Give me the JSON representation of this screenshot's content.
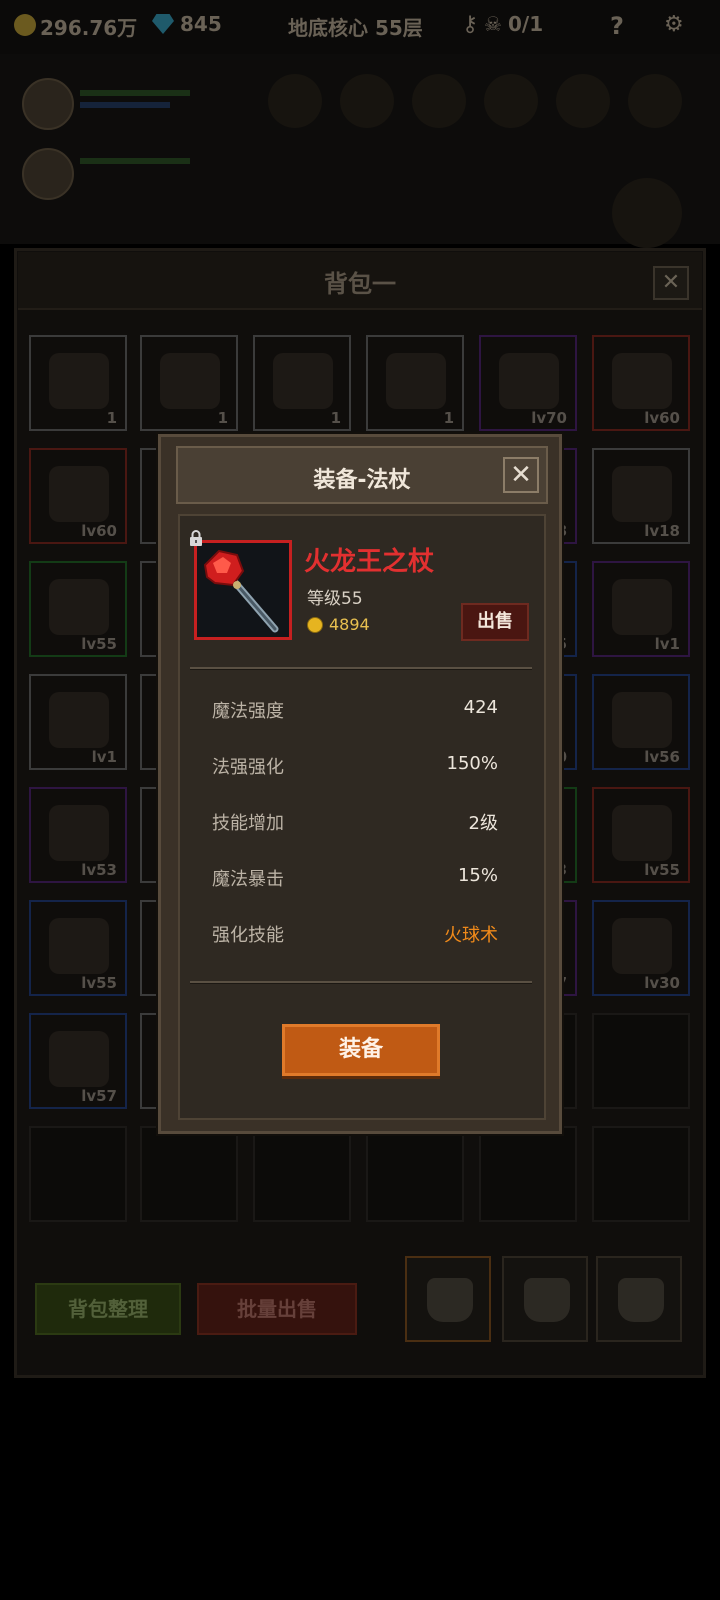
{
  "topbar": {
    "gold": "296.76万",
    "gems": "845",
    "location": "地底核心 55层",
    "keys": "0/1"
  },
  "bag": {
    "title": "背包一",
    "close_label": "✕",
    "slots": [
      {
        "count": "1"
      },
      {
        "count": "1"
      },
      {
        "count": "1"
      },
      {
        "count": "1"
      },
      {
        "count": "lv70"
      },
      {
        "count": "lv60"
      },
      {
        "count": "lv60"
      },
      {
        "count": ""
      },
      {
        "count": ""
      },
      {
        "count": ""
      },
      {
        "count": "8"
      },
      {
        "count": "lv18"
      },
      {
        "count": "lv55"
      },
      {
        "count": ""
      },
      {
        "count": ""
      },
      {
        "count": ""
      },
      {
        "count": "5"
      },
      {
        "count": "lv1"
      },
      {
        "count": "lv1"
      },
      {
        "count": ""
      },
      {
        "count": ""
      },
      {
        "count": ""
      },
      {
        "count": "0"
      },
      {
        "count": "lv56"
      },
      {
        "count": "lv53"
      },
      {
        "count": ""
      },
      {
        "count": ""
      },
      {
        "count": ""
      },
      {
        "count": "3"
      },
      {
        "count": "lv55"
      },
      {
        "count": "lv55"
      },
      {
        "count": ""
      },
      {
        "count": ""
      },
      {
        "count": ""
      },
      {
        "count": "7"
      },
      {
        "count": "lv30"
      },
      {
        "count": "lv57"
      },
      {
        "count": ""
      },
      {
        "count": ""
      },
      {
        "count": ""
      },
      {
        "count": ""
      },
      {
        "count": ""
      }
    ],
    "sort_label": "背包整理",
    "batch_sell_label": "批量出售"
  },
  "dialog": {
    "title": "装备-法杖",
    "close_label": "✕",
    "item_name": "火龙王之杖",
    "item_level": "等级55",
    "price": "4894",
    "sell_label": "出售",
    "stats": [
      {
        "label": "魔法强度",
        "value": "424"
      },
      {
        "label": "法强强化",
        "value": "150%"
      },
      {
        "label": "技能增加",
        "value": "2级"
      },
      {
        "label": "魔法暴击",
        "value": "15%"
      },
      {
        "label": "强化技能",
        "value": "火球术"
      }
    ],
    "equip_label": "装备",
    "name_color": "#e23030",
    "accent_color": "#f08a1a"
  }
}
